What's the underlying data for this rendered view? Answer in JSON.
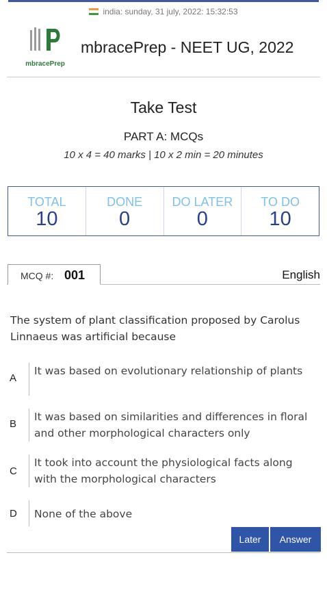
{
  "status": {
    "text": "india: sunday, 31 july, 2022: 15:32:53",
    "flag_icon": "india-flag-icon"
  },
  "header": {
    "logo_text": "mbracePrep",
    "app_title": "mbracePrep - NEET UG, 2022"
  },
  "page": {
    "title": "Take Test",
    "part": "PART A: MCQs",
    "marks_info": "10 x 4 = 40 marks | 10 x 2 min = 20 minutes"
  },
  "stats": [
    {
      "label": "TOTAL",
      "value": "10"
    },
    {
      "label": "DONE",
      "value": "0"
    },
    {
      "label": "DO LATER",
      "value": "0"
    },
    {
      "label": "TO DO",
      "value": "10"
    }
  ],
  "mcq": {
    "label": "MCQ #:",
    "number": "001",
    "language": "English"
  },
  "question": {
    "text": "The system of plant classification proposed by Carolus Linnaeus was artificial because",
    "options": [
      {
        "letter": "A",
        "text": "It was based on evolutionary relationship of plants"
      },
      {
        "letter": "B",
        "text": "It was based on similarities and differences in floral and other morphological characters only"
      },
      {
        "letter": "C",
        "text": "It took into account the physiological facts along with the morphological characters"
      },
      {
        "letter": "D",
        "text": "None of the above"
      }
    ]
  },
  "buttons": {
    "later": "Later",
    "answer": "Answer"
  },
  "colors": {
    "accent": "#2f55a8",
    "stat_label": "#7ec1ea",
    "stat_value": "#28408c",
    "logo_green": "#2d7a3a"
  }
}
